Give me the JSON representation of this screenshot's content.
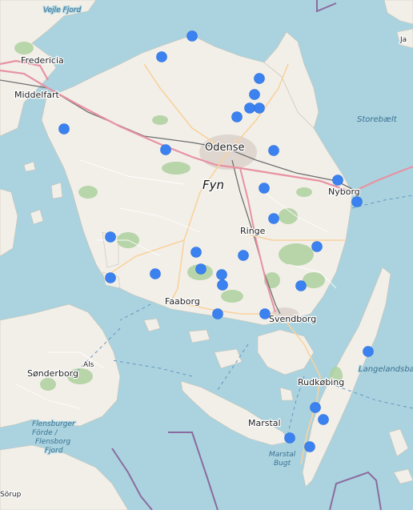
{
  "map": {
    "region_label": "Fyn",
    "colors": {
      "water": "#aad3df",
      "land": "#f2efe9",
      "forest": "#add19e",
      "field": "#c8e6b0",
      "motorway": "#e892a2",
      "primary_road": "#f9d29c",
      "railway": "#707070",
      "border": "#8b6b9e",
      "marker": "#3b82f0"
    },
    "labels": {
      "vejle_fjord": "Vejle Fjord",
      "fredericia": "Fredericia",
      "middelfart": "Middelfart",
      "odense": "Odense",
      "fyn": "Fyn",
      "nyborg": "Nyborg",
      "storebaelt": "Storebælt",
      "ringe": "Ringe",
      "faaborg": "Faaborg",
      "svendborg": "Svendborg",
      "als": "Als",
      "sonderborg": "Sønderborg",
      "flensburger_forde": "Flensburger",
      "flensburger_forde_2": "Förde /",
      "flensborg_fjord": "Flensborg",
      "flensborg_fjord_2": "Fjord",
      "rudkobing": "Rudkøbing",
      "langelandsbaelt": "Langelandsbælt",
      "marstal": "Marstal",
      "marstal_bugt": "Marstal",
      "marstal_bugt_2": "Bugt",
      "sorup": "Sörup",
      "ja_partial": "Ja"
    },
    "marker_count": 32,
    "marker_icon": "location-dot-icon"
  }
}
